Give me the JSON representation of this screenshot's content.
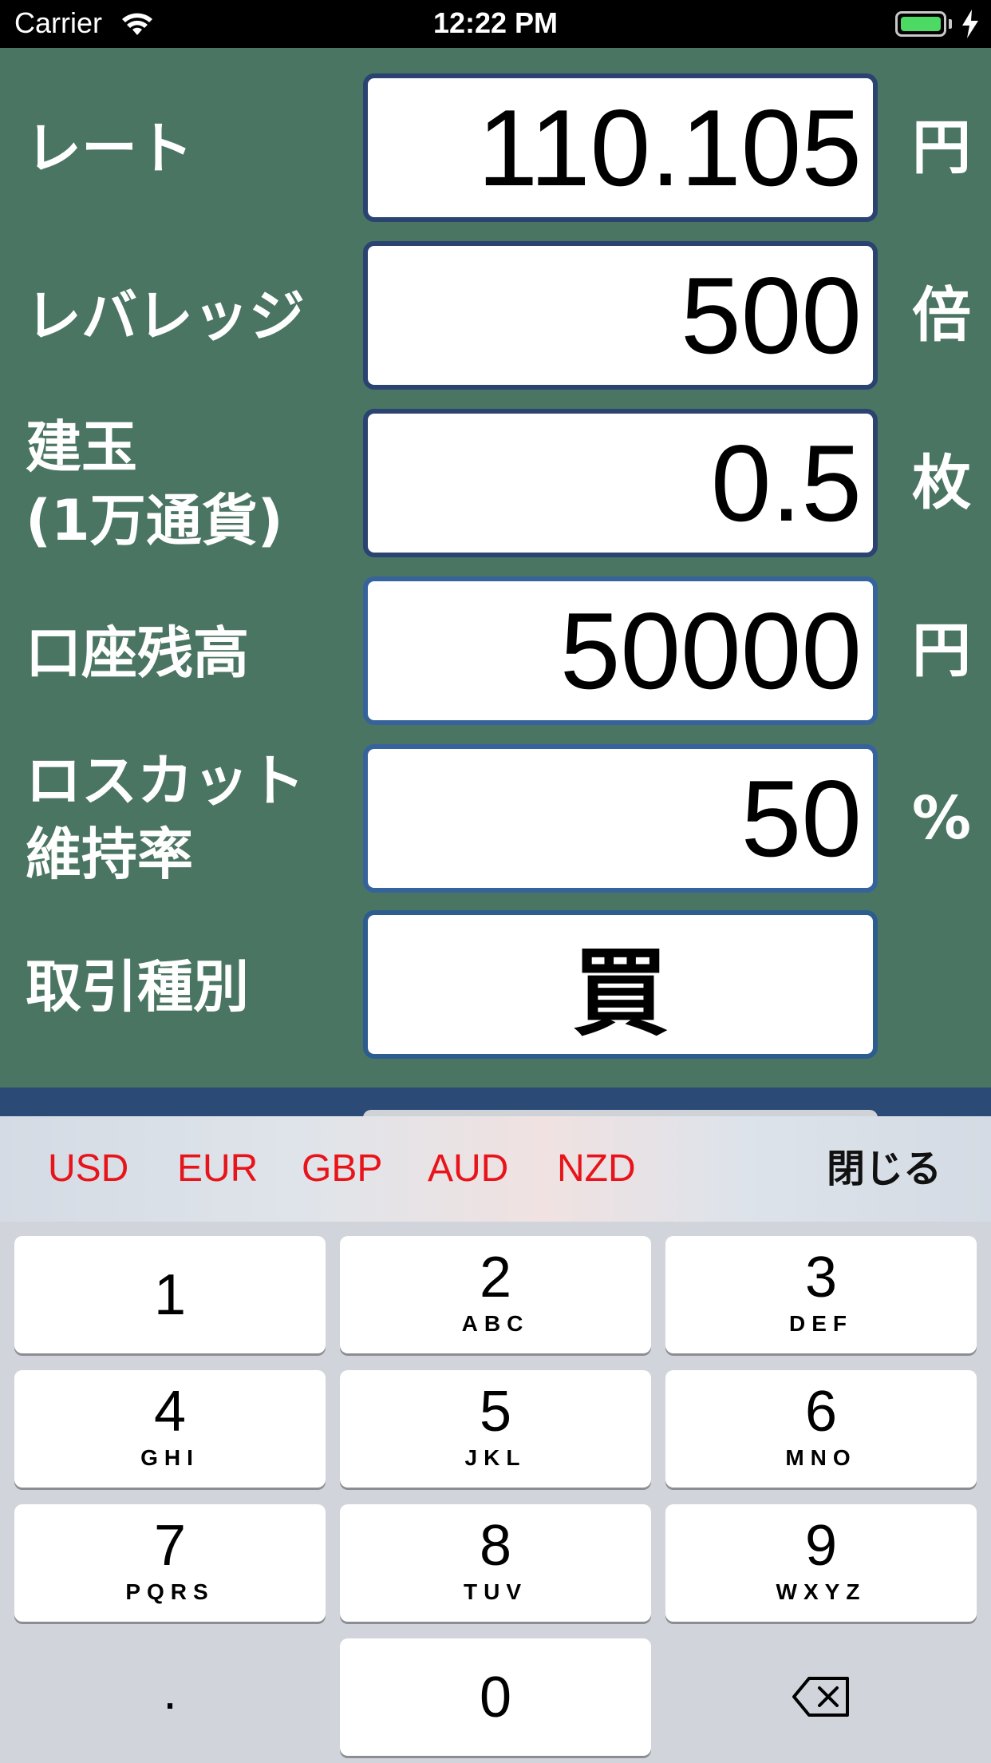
{
  "status_bar": {
    "carrier": "Carrier",
    "time": "12:22 PM",
    "battery_color": "#4cd964"
  },
  "form": {
    "rows": [
      {
        "label": "レート",
        "value": "110.105",
        "unit": "円"
      },
      {
        "label": "レバレッジ",
        "value": "500",
        "unit": "倍"
      },
      {
        "label_line1": "建玉",
        "label_line2": "(1万通貨)",
        "value": "0.5",
        "unit": "枚"
      },
      {
        "label": "口座残高",
        "value": "50000",
        "unit": "円"
      },
      {
        "label_line1": "ロスカット",
        "label_line2": "維持率",
        "value": "50",
        "unit": "%"
      },
      {
        "label": "取引種別",
        "value": "買"
      }
    ]
  },
  "toolbar": {
    "currencies": [
      "USD",
      "EUR",
      "GBP",
      "AUD",
      "NZD"
    ],
    "close_label": "閉じる",
    "currency_color": "#e8141b"
  },
  "keyboard": {
    "keys": [
      {
        "num": "1",
        "letters": ""
      },
      {
        "num": "2",
        "letters": "ABC"
      },
      {
        "num": "3",
        "letters": "DEF"
      },
      {
        "num": "4",
        "letters": "GHI"
      },
      {
        "num": "5",
        "letters": "JKL"
      },
      {
        "num": "6",
        "letters": "MNO"
      },
      {
        "num": "7",
        "letters": "PQRS"
      },
      {
        "num": "8",
        "letters": "TUV"
      },
      {
        "num": "9",
        "letters": "WXYZ"
      },
      {
        "num": "0",
        "letters": ""
      }
    ],
    "decimal": ".",
    "delete_icon": "backspace-icon"
  },
  "colors": {
    "background": "#4b7563",
    "field_border": "#2a4370",
    "keyboard_bg": "#d1d5db"
  }
}
